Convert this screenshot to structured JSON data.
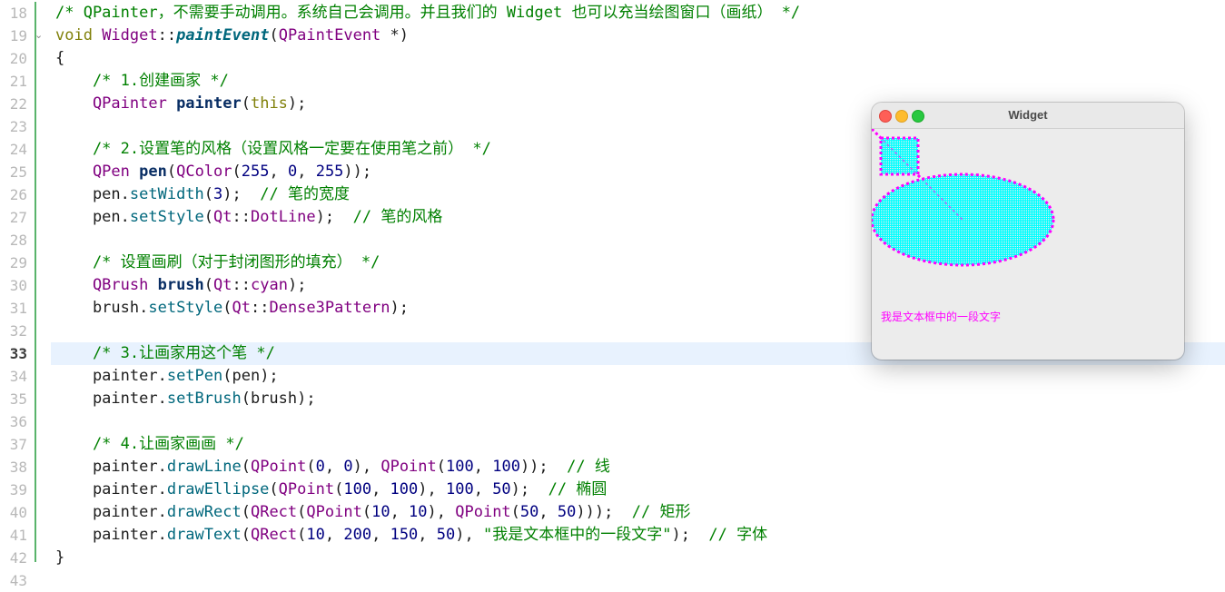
{
  "editor": {
    "current_line": 33,
    "lines": [
      {
        "n": 18,
        "t": [
          [
            "cm",
            "/* QPainter，不需要手动调用。系统自己会调用。并且我们的 Widget 也可以充当绘图窗口（画纸） */"
          ]
        ]
      },
      {
        "n": 19,
        "t": [
          [
            "kw",
            "void "
          ],
          [
            "ty",
            "Widget"
          ],
          [
            "pl",
            "::"
          ],
          [
            "fnd",
            "paintEvent"
          ],
          [
            "pl",
            "("
          ],
          [
            "ty",
            "QPaintEvent"
          ],
          [
            "pl",
            " *)"
          ]
        ]
      },
      {
        "n": 20,
        "t": [
          [
            "pl",
            "{"
          ]
        ]
      },
      {
        "n": 21,
        "t": [
          [
            "cm",
            "    /* 1.创建画家 */"
          ]
        ]
      },
      {
        "n": 22,
        "t": [
          [
            "ty",
            "    QPainter "
          ],
          [
            "var",
            "painter"
          ],
          [
            "pl",
            "("
          ],
          [
            "kw",
            "this"
          ],
          [
            "pl",
            ");"
          ]
        ]
      },
      {
        "n": 23,
        "t": []
      },
      {
        "n": 24,
        "t": [
          [
            "cm",
            "    /* 2.设置笔的风格（设置风格一定要在使用笔之前） */"
          ]
        ]
      },
      {
        "n": 25,
        "t": [
          [
            "ty",
            "    QPen "
          ],
          [
            "var",
            "pen"
          ],
          [
            "pl",
            "("
          ],
          [
            "ty",
            "QColor"
          ],
          [
            "pl",
            "("
          ],
          [
            "num",
            "255"
          ],
          [
            "pl",
            ", "
          ],
          [
            "num",
            "0"
          ],
          [
            "pl",
            ", "
          ],
          [
            "num",
            "255"
          ],
          [
            "pl",
            "));"
          ]
        ]
      },
      {
        "n": 26,
        "t": [
          [
            "pl",
            "    pen."
          ],
          [
            "fn",
            "setWidth"
          ],
          [
            "pl",
            "("
          ],
          [
            "num",
            "3"
          ],
          [
            "pl",
            ");  "
          ],
          [
            "cm",
            "// 笔的宽度"
          ]
        ]
      },
      {
        "n": 27,
        "t": [
          [
            "pl",
            "    pen."
          ],
          [
            "fn",
            "setStyle"
          ],
          [
            "pl",
            "("
          ],
          [
            "ty",
            "Qt"
          ],
          [
            "pl",
            "::"
          ],
          [
            "en",
            "DotLine"
          ],
          [
            "pl",
            ");  "
          ],
          [
            "cm",
            "// 笔的风格"
          ]
        ]
      },
      {
        "n": 28,
        "t": []
      },
      {
        "n": 29,
        "t": [
          [
            "cm",
            "    /* 设置画刷（对于封闭图形的填充） */"
          ]
        ]
      },
      {
        "n": 30,
        "t": [
          [
            "ty",
            "    QBrush "
          ],
          [
            "var",
            "brush"
          ],
          [
            "pl",
            "("
          ],
          [
            "ty",
            "Qt"
          ],
          [
            "pl",
            "::"
          ],
          [
            "en",
            "cyan"
          ],
          [
            "pl",
            ");"
          ]
        ]
      },
      {
        "n": 31,
        "t": [
          [
            "pl",
            "    brush."
          ],
          [
            "fn",
            "setStyle"
          ],
          [
            "pl",
            "("
          ],
          [
            "ty",
            "Qt"
          ],
          [
            "pl",
            "::"
          ],
          [
            "en",
            "Dense3Pattern"
          ],
          [
            "pl",
            ");"
          ]
        ]
      },
      {
        "n": 32,
        "t": []
      },
      {
        "n": 33,
        "t": [
          [
            "cm",
            "    /* 3.让画家用这个笔 */"
          ]
        ]
      },
      {
        "n": 34,
        "t": [
          [
            "pl",
            "    painter."
          ],
          [
            "fn",
            "setPen"
          ],
          [
            "pl",
            "(pen);"
          ]
        ]
      },
      {
        "n": 35,
        "t": [
          [
            "pl",
            "    painter."
          ],
          [
            "fn",
            "setBrush"
          ],
          [
            "pl",
            "(brush);"
          ]
        ]
      },
      {
        "n": 36,
        "t": []
      },
      {
        "n": 37,
        "t": [
          [
            "cm",
            "    /* 4.让画家画画 */"
          ]
        ]
      },
      {
        "n": 38,
        "t": [
          [
            "pl",
            "    painter."
          ],
          [
            "fn",
            "drawLine"
          ],
          [
            "pl",
            "("
          ],
          [
            "ty",
            "QPoint"
          ],
          [
            "pl",
            "("
          ],
          [
            "num",
            "0"
          ],
          [
            "pl",
            ", "
          ],
          [
            "num",
            "0"
          ],
          [
            "pl",
            "), "
          ],
          [
            "ty",
            "QPoint"
          ],
          [
            "pl",
            "("
          ],
          [
            "num",
            "100"
          ],
          [
            "pl",
            ", "
          ],
          [
            "num",
            "100"
          ],
          [
            "pl",
            "));  "
          ],
          [
            "cm",
            "// 线"
          ]
        ]
      },
      {
        "n": 39,
        "t": [
          [
            "pl",
            "    painter."
          ],
          [
            "fn",
            "drawEllipse"
          ],
          [
            "pl",
            "("
          ],
          [
            "ty",
            "QPoint"
          ],
          [
            "pl",
            "("
          ],
          [
            "num",
            "100"
          ],
          [
            "pl",
            ", "
          ],
          [
            "num",
            "100"
          ],
          [
            "pl",
            "), "
          ],
          [
            "num",
            "100"
          ],
          [
            "pl",
            ", "
          ],
          [
            "num",
            "50"
          ],
          [
            "pl",
            ");  "
          ],
          [
            "cm",
            "// 椭圆"
          ]
        ]
      },
      {
        "n": 40,
        "t": [
          [
            "pl",
            "    painter."
          ],
          [
            "fn",
            "drawRect"
          ],
          [
            "pl",
            "("
          ],
          [
            "ty",
            "QRect"
          ],
          [
            "pl",
            "("
          ],
          [
            "ty",
            "QPoint"
          ],
          [
            "pl",
            "("
          ],
          [
            "num",
            "10"
          ],
          [
            "pl",
            ", "
          ],
          [
            "num",
            "10"
          ],
          [
            "pl",
            "), "
          ],
          [
            "ty",
            "QPoint"
          ],
          [
            "pl",
            "("
          ],
          [
            "num",
            "50"
          ],
          [
            "pl",
            ", "
          ],
          [
            "num",
            "50"
          ],
          [
            "pl",
            ")));  "
          ],
          [
            "cm",
            "// 矩形"
          ]
        ]
      },
      {
        "n": 41,
        "t": [
          [
            "pl",
            "    painter."
          ],
          [
            "fn",
            "drawText"
          ],
          [
            "pl",
            "("
          ],
          [
            "ty",
            "QRect"
          ],
          [
            "pl",
            "("
          ],
          [
            "num",
            "10"
          ],
          [
            "pl",
            ", "
          ],
          [
            "num",
            "200"
          ],
          [
            "pl",
            ", "
          ],
          [
            "num",
            "150"
          ],
          [
            "pl",
            ", "
          ],
          [
            "num",
            "50"
          ],
          [
            "pl",
            "), "
          ],
          [
            "str",
            "\"我是文本框中的一段文字\""
          ],
          [
            "pl",
            ");  "
          ],
          [
            "cm",
            "// 字体"
          ]
        ]
      },
      {
        "n": 42,
        "t": [
          [
            "pl",
            "}"
          ]
        ]
      },
      {
        "n": 43,
        "t": []
      }
    ]
  },
  "widget_window": {
    "title": "Widget",
    "canvas_text": "我是文本框中的一段文字",
    "colors": {
      "pen": "#ff00ff",
      "brush": "#00ffff",
      "background": "#ececec"
    }
  }
}
